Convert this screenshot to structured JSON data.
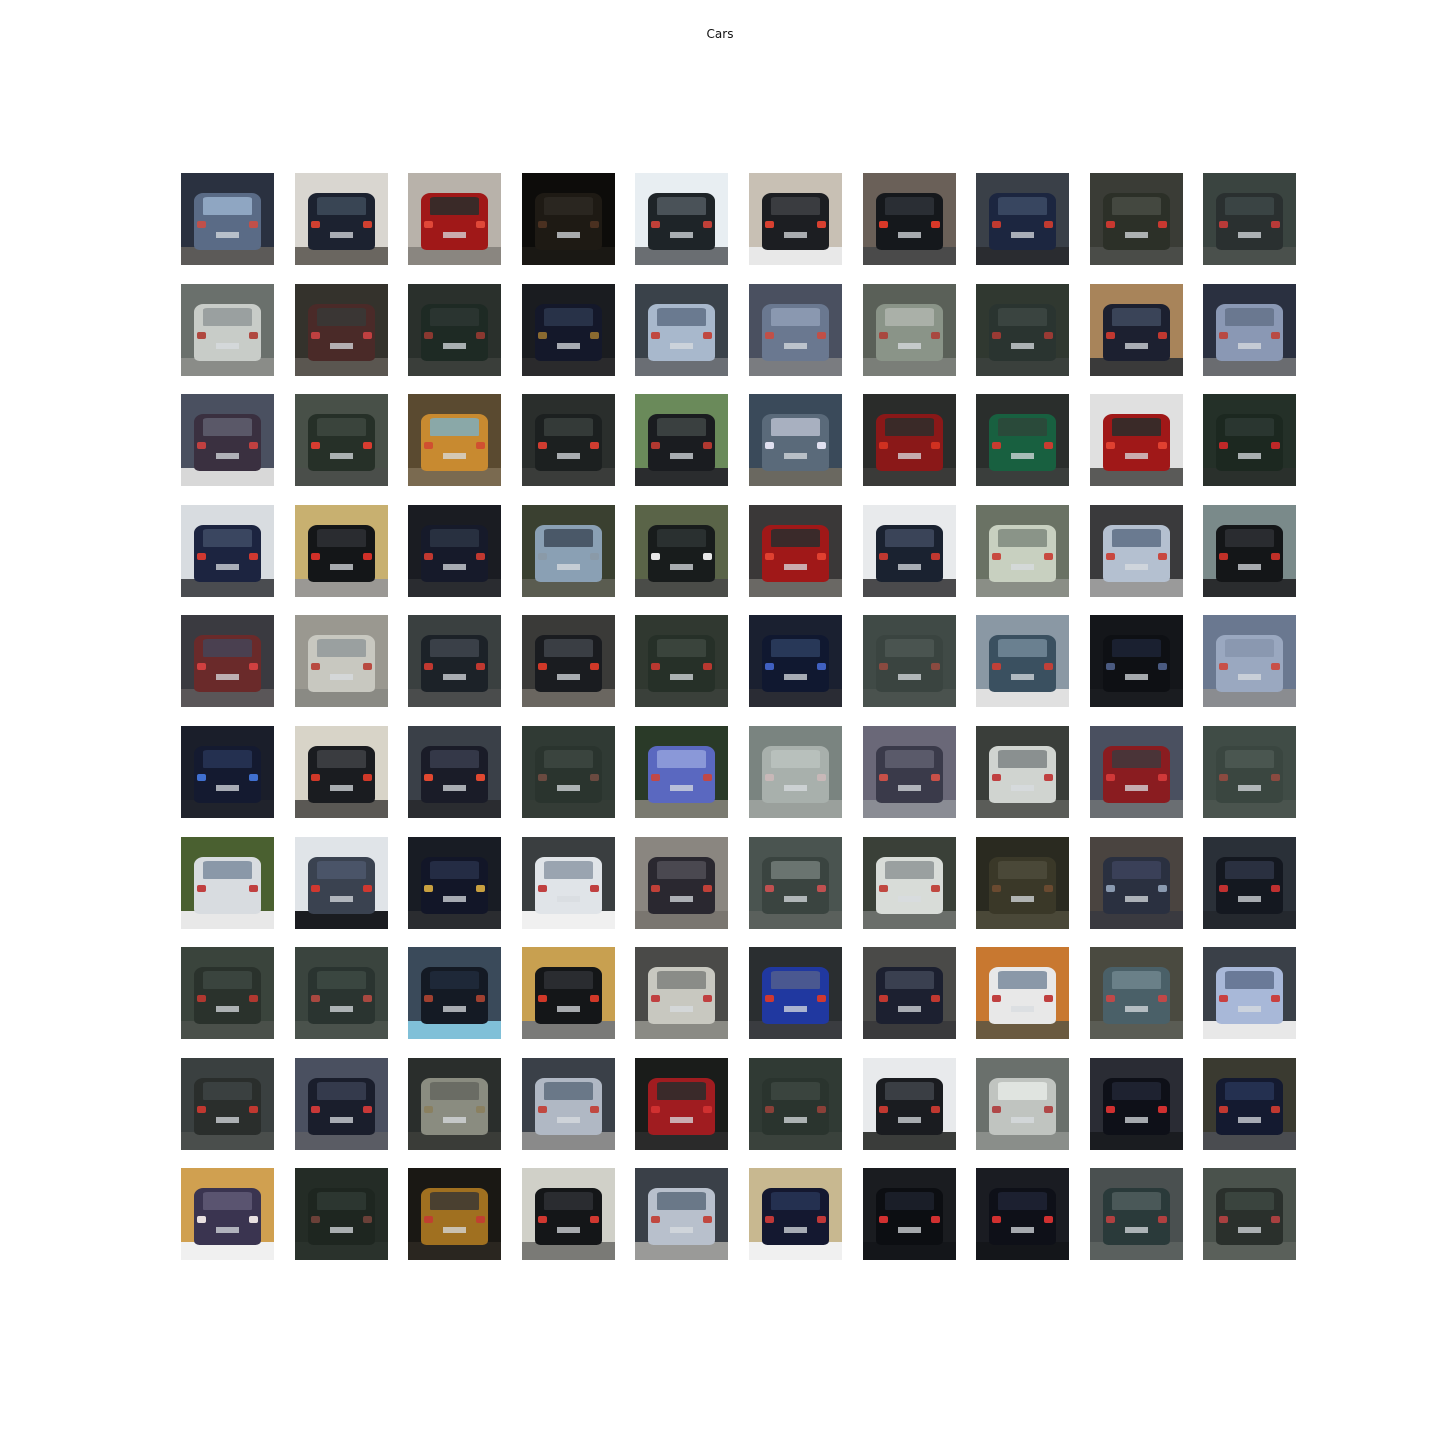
{
  "figure": {
    "title": "Cars"
  },
  "grid": {
    "rows": 10,
    "cols": 10,
    "thumbnails": [
      {
        "body": "#5a6b86",
        "bg": "#2a3140",
        "road": "#5c5a58",
        "light": "#c0504a",
        "window": "#8fa6c2"
      },
      {
        "body": "#1c2230",
        "bg": "#d9d6d0",
        "road": "#6a6660",
        "light": "#d04030",
        "window": "#394554"
      },
      {
        "body": "#a01818",
        "bg": "#b8b2aa",
        "road": "#8a8680",
        "light": "#e04838",
        "window": "#3a2a28"
      },
      {
        "body": "#1e1a14",
        "bg": "#0d0c0a",
        "road": "#1a1814",
        "light": "#4a3020",
        "window": "#2a2620"
      },
      {
        "body": "#1e2428",
        "bg": "#e8eef2",
        "road": "#6a6e72",
        "light": "#c04038",
        "window": "#4a5258"
      },
      {
        "body": "#1c1e22",
        "bg": "#c8c0b4",
        "road": "#e8e8e8",
        "light": "#d84030",
        "window": "#3a3c40"
      },
      {
        "body": "#15181c",
        "bg": "#6a6058",
        "road": "#4a4a4a",
        "light": "#d83828",
        "window": "#2a2e34"
      },
      {
        "body": "#1c2640",
        "bg": "#3a4048",
        "road": "#2a2c30",
        "light": "#c03a30",
        "window": "#384660"
      },
      {
        "body": "#2c3028",
        "bg": "#3a3c36",
        "road": "#4a4c48",
        "light": "#c83830",
        "window": "#444840"
      },
      {
        "body": "#2a3030",
        "bg": "#3a4440",
        "road": "#4a504c",
        "light": "#b83a38",
        "window": "#3a4444"
      },
      {
        "body": "#c8ccc8",
        "bg": "#6a706c",
        "road": "#8a8c88",
        "light": "#b04840",
        "window": "#9aa0a0"
      },
      {
        "body": "#4a2a28",
        "bg": "#34322c",
        "road": "#5a5650",
        "light": "#c04040",
        "window": "#3a3634"
      },
      {
        "body": "#1e2a24",
        "bg": "#2a302c",
        "road": "#3a3e3a",
        "light": "#8a3830",
        "window": "#2a3430"
      },
      {
        "body": "#14182a",
        "bg": "#1a1c20",
        "road": "#2a2a2c",
        "light": "#8a6a30",
        "window": "#283248"
      },
      {
        "body": "#a8b8cc",
        "bg": "#3a424a",
        "road": "#6a6e74",
        "light": "#c04840",
        "window": "#6a7a90"
      },
      {
        "body": "#6a7890",
        "bg": "#4a5060",
        "road": "#7a7c80",
        "light": "#c05048",
        "window": "#8a98b0"
      },
      {
        "body": "#8a9488",
        "bg": "#5a6058",
        "road": "#7a7e78",
        "light": "#a84840",
        "window": "#aab0a8"
      },
      {
        "body": "#2a3430",
        "bg": "#303830",
        "road": "#3a403c",
        "light": "#9a3a34",
        "window": "#3a4440"
      },
      {
        "body": "#1c2030",
        "bg": "#a8845a",
        "road": "#3a3a3a",
        "light": "#c03830",
        "window": "#3a4458"
      },
      {
        "body": "#8a98b4",
        "bg": "#2a3040",
        "road": "#6a6c70",
        "light": "#b84a44",
        "window": "#6a7890"
      },
      {
        "body": "#3a3040",
        "bg": "#4a5060",
        "road": "#d8d8d8",
        "light": "#c04040",
        "window": "#5a5868"
      },
      {
        "body": "#263028",
        "bg": "#485048",
        "road": "#4a4e4a",
        "light": "#d83c30",
        "window": "#3a443c"
      },
      {
        "body": "#c88a30",
        "bg": "#5a4a30",
        "road": "#7a6a50",
        "light": "#d05030",
        "window": "#8aa8a8"
      },
      {
        "body": "#1c2020",
        "bg": "#2a2e2c",
        "road": "#3a3c3a",
        "light": "#d03c30",
        "window": "#343a38"
      },
      {
        "body": "#1a1c20",
        "bg": "#6a8a5a",
        "road": "#2a2c2e",
        "light": "#b03830",
        "window": "#3a4040"
      },
      {
        "body": "#5a6a7a",
        "bg": "#3a4a5a",
        "road": "#6a6860",
        "light": "#e0e0f0",
        "window": "#a8b0c0"
      },
      {
        "body": "#8a1818",
        "bg": "#2a2c2a",
        "road": "#3a3a38",
        "light": "#d03020",
        "window": "#3a2a28"
      },
      {
        "body": "#186040",
        "bg": "#2a2e2c",
        "road": "#3a3e3c",
        "light": "#c83c30",
        "window": "#2a4a3a"
      },
      {
        "body": "#a01818",
        "bg": "#e0e0e0",
        "road": "#5a5a58",
        "light": "#e04030",
        "window": "#3a2a28"
      },
      {
        "body": "#1c2820",
        "bg": "#243028",
        "road": "#2a302c",
        "light": "#c02828",
        "window": "#2a3630"
      },
      {
        "body": "#1c2440",
        "bg": "#d8dce0",
        "road": "#4a4c50",
        "light": "#d03830",
        "window": "#3a4660"
      },
      {
        "body": "#141618",
        "bg": "#c8b070",
        "road": "#9a9894",
        "light": "#d03028",
        "window": "#2a2c30"
      },
      {
        "body": "#161a2a",
        "bg": "#1a1c22",
        "road": "#2a2c30",
        "light": "#c03830",
        "window": "#283040"
      },
      {
        "body": "#8aa0b4",
        "bg": "#3a4030",
        "road": "#5a5c50",
        "light": "#8a9aa8",
        "window": "#4a5868"
      },
      {
        "body": "#181c1c",
        "bg": "#5a6448",
        "road": "#4a4c48",
        "light": "#e8e8e8",
        "window": "#2a3030"
      },
      {
        "body": "#a01818",
        "bg": "#3a3838",
        "road": "#6a6864",
        "light": "#e04030",
        "window": "#3a2a2a"
      },
      {
        "body": "#1a2230",
        "bg": "#e8eaec",
        "road": "#4a4a4c",
        "light": "#c03830",
        "window": "#3a4458"
      },
      {
        "body": "#c8d0c0",
        "bg": "#6a7264",
        "road": "#8a8e86",
        "light": "#c84a40",
        "window": "#8a9488"
      },
      {
        "body": "#b4c0d0",
        "bg": "#3a3a3c",
        "road": "#9a9a9a",
        "light": "#c84840",
        "window": "#6a7a90"
      },
      {
        "body": "#141618",
        "bg": "#7a8a8a",
        "road": "#2a2c2e",
        "light": "#c03028",
        "window": "#2a2c30"
      },
      {
        "body": "#6a2a2a",
        "bg": "#3a3a40",
        "road": "#5a5658",
        "light": "#d04040",
        "window": "#4a4050"
      },
      {
        "body": "#c8c8c0",
        "bg": "#9a9890",
        "road": "#8a8a84",
        "light": "#b84a40",
        "window": "#9aa0a0"
      },
      {
        "body": "#1c2228",
        "bg": "#3a4040",
        "road": "#4a4c4c",
        "light": "#c03830",
        "window": "#3a4048"
      },
      {
        "body": "#1a1c20",
        "bg": "#3a3a38",
        "road": "#6a6660",
        "light": "#d03828",
        "window": "#3a3e44"
      },
      {
        "body": "#263028",
        "bg": "#303830",
        "road": "#3a403a",
        "light": "#b83830",
        "window": "#3a443c"
      },
      {
        "body": "#101830",
        "bg": "#1a2030",
        "road": "#2a2c34",
        "light": "#4060c0",
        "window": "#283858"
      },
      {
        "body": "#3a4440",
        "bg": "#404a46",
        "road": "#4a524e",
        "light": "#8a4a40",
        "window": "#4a5450"
      },
      {
        "body": "#3a5060",
        "bg": "#8a98a4",
        "road": "#e0e0e0",
        "light": "#c04038",
        "window": "#6a8090"
      },
      {
        "body": "#0e1014",
        "bg": "#14161a",
        "road": "#1a1c20",
        "light": "#4a5a80",
        "window": "#1a2030"
      },
      {
        "body": "#9aa8c0",
        "bg": "#6a7890",
        "road": "#8a8c90",
        "light": "#c85048",
        "window": "#8a98b0"
      },
      {
        "body": "#141a30",
        "bg": "#1a1e2a",
        "road": "#20232c",
        "light": "#4070d0",
        "window": "#243050"
      },
      {
        "body": "#1a1c20",
        "bg": "#d8d4c8",
        "road": "#5a5854",
        "light": "#d03828",
        "window": "#3a3c40"
      },
      {
        "body": "#1a1c28",
        "bg": "#3a4048",
        "road": "#2a2c30",
        "light": "#e04830",
        "window": "#343848"
      },
      {
        "body": "#2a342e",
        "bg": "#303a34",
        "road": "#343c36",
        "light": "#6a4a40",
        "window": "#3a443e"
      },
      {
        "body": "#5a68c0",
        "bg": "#2a3a28",
        "road": "#7a7a70",
        "light": "#c04848",
        "window": "#8a98d8"
      },
      {
        "body": "#a8b0ac",
        "bg": "#7a8480",
        "road": "#9aa09c",
        "light": "#c8b8b8",
        "window": "#b8c0bc"
      },
      {
        "body": "#3a3a4a",
        "bg": "#6a6878",
        "road": "#8a8c94",
        "light": "#c85048",
        "window": "#5a5a6a"
      },
      {
        "body": "#d0d4d0",
        "bg": "#3a3e3a",
        "road": "#5a5c58",
        "light": "#c04040",
        "window": "#8a9090"
      },
      {
        "body": "#8a1c20",
        "bg": "#4a5060",
        "road": "#6a6e72",
        "light": "#d03838",
        "window": "#4a3438"
      },
      {
        "body": "#3a4640",
        "bg": "#404c46",
        "road": "#4a544e",
        "light": "#8a4a40",
        "window": "#4a5650"
      },
      {
        "body": "#d8dce0",
        "bg": "#4a6030",
        "road": "#e8e8e8",
        "light": "#c04040",
        "window": "#8a98a8"
      },
      {
        "body": "#3a4250",
        "bg": "#e0e4e8",
        "road": "#1a1c20",
        "light": "#d03830",
        "window": "#4a5468"
      },
      {
        "body": "#121628",
        "bg": "#181c24",
        "road": "#2a2c30",
        "light": "#c8a040",
        "window": "#242c44"
      },
      {
        "body": "#e0e4e8",
        "bg": "#3a3e40",
        "road": "#f0f0f0",
        "light": "#c04040",
        "window": "#9aa4b0"
      },
      {
        "body": "#2a2830",
        "bg": "#8a8680",
        "road": "#7a7670",
        "light": "#c04038",
        "window": "#4a4850"
      },
      {
        "body": "#3a4440",
        "bg": "#4a5450",
        "road": "#5a605c",
        "light": "#c05050",
        "window": "#6a7470"
      },
      {
        "body": "#d8dcd8",
        "bg": "#3a4038",
        "road": "#6a6e6a",
        "light": "#c04840",
        "window": "#9aa0a0"
      },
      {
        "body": "#3a3828",
        "bg": "#2a2a20",
        "road": "#4a4838",
        "light": "#6a4a30",
        "window": "#4a4838"
      },
      {
        "body": "#2a3040",
        "bg": "#4a4440",
        "road": "#3a3a40",
        "light": "#8a9ab0",
        "window": "#3a4058"
      },
      {
        "body": "#141820",
        "bg": "#2a3038",
        "road": "#24282e",
        "light": "#c03030",
        "window": "#2a3040"
      },
      {
        "body": "#2a322c",
        "bg": "#3a443c",
        "road": "#4a504a",
        "light": "#b03830",
        "window": "#3a443e"
      },
      {
        "body": "#2a3430",
        "bg": "#3a443e",
        "road": "#4a524c",
        "light": "#a84840",
        "window": "#3a4640"
      },
      {
        "body": "#141a24",
        "bg": "#3a4a5a",
        "road": "#80c0d8",
        "light": "#a04030",
        "window": "#1e2838"
      },
      {
        "body": "#141618",
        "bg": "#c8a050",
        "road": "#7a7a78",
        "light": "#d03828",
        "window": "#2a2c30"
      },
      {
        "body": "#c8c8c0",
        "bg": "#4a4a48",
        "road": "#8a8a84",
        "light": "#c04040",
        "window": "#8a8c88"
      },
      {
        "body": "#2038a0",
        "bg": "#2a2e30",
        "road": "#3a3c40",
        "light": "#d03830",
        "window": "#4a5890"
      },
      {
        "body": "#1c2030",
        "bg": "#4a4a48",
        "road": "#3a3a3c",
        "light": "#c03830",
        "window": "#3a4050"
      },
      {
        "body": "#e8e8e8",
        "bg": "#c87830",
        "road": "#6a5a40",
        "light": "#c04040",
        "window": "#8a98a8"
      },
      {
        "body": "#4a6068",
        "bg": "#4a4a40",
        "road": "#5a5c54",
        "light": "#c04848",
        "window": "#6a8088"
      },
      {
        "body": "#a8b8d8",
        "bg": "#3a4048",
        "road": "#e8e8e8",
        "light": "#c84040",
        "window": "#6a7a98"
      },
      {
        "body": "#2a2e2c",
        "bg": "#3a4040",
        "road": "#4a4e4c",
        "light": "#c03830",
        "window": "#3a4040"
      },
      {
        "body": "#1a1e2c",
        "bg": "#4a5060",
        "road": "#5a5c64",
        "light": "#c83838",
        "window": "#343a4c"
      },
      {
        "body": "#8a8c80",
        "bg": "#2a2e2c",
        "road": "#3a3c38",
        "light": "#8a8060",
        "window": "#6a6c64"
      },
      {
        "body": "#b0b8c4",
        "bg": "#3a4048",
        "road": "#8a8a8a",
        "light": "#c04840",
        "window": "#6a7888"
      },
      {
        "body": "#a01c20",
        "bg": "#1a1c1a",
        "road": "#2a2a2a",
        "light": "#d03030",
        "window": "#3a2a2a"
      },
      {
        "body": "#2a342e",
        "bg": "#303a34",
        "road": "#3a423c",
        "light": "#8a4038",
        "window": "#3a443e"
      },
      {
        "body": "#1a1c20",
        "bg": "#e8eaec",
        "road": "#3a3c3a",
        "light": "#c03830",
        "window": "#3a3e44"
      },
      {
        "body": "#c0c4c0",
        "bg": "#6a706c",
        "road": "#8a8e8a",
        "light": "#b04848",
        "window": "#e0e4e0"
      },
      {
        "body": "#0e1018",
        "bg": "#2a2c34",
        "road": "#1a1c20",
        "light": "#d03030",
        "window": "#1e2230"
      },
      {
        "body": "#141a30",
        "bg": "#3a3a30",
        "road": "#4a4c50",
        "light": "#c03830",
        "window": "#243050"
      },
      {
        "body": "#3a3450",
        "bg": "#d0a050",
        "road": "#f0f0f0",
        "light": "#e8e0e0",
        "window": "#5a5470"
      },
      {
        "body": "#1e2620",
        "bg": "#242c26",
        "road": "#2a322c",
        "light": "#6a4038",
        "window": "#2c3630"
      },
      {
        "body": "#a07020",
        "bg": "#1a1814",
        "road": "#2a2620",
        "light": "#c04030",
        "window": "#4a4030"
      },
      {
        "body": "#141618",
        "bg": "#d0d0c8",
        "road": "#7a7a76",
        "light": "#d03830",
        "window": "#2a2c30"
      },
      {
        "body": "#b8c0cc",
        "bg": "#3a4048",
        "road": "#9a9a98",
        "light": "#c04840",
        "window": "#6a7888"
      },
      {
        "body": "#141830",
        "bg": "#c8b890",
        "road": "#f0f0f0",
        "light": "#c03838",
        "window": "#243050"
      },
      {
        "body": "#0c0e12",
        "bg": "#1a1c20",
        "road": "#14161a",
        "light": "#d03030",
        "window": "#1a1e28"
      },
      {
        "body": "#0e1018",
        "bg": "#1a1c22",
        "road": "#14161a",
        "light": "#d03030",
        "window": "#1c2030"
      },
      {
        "body": "#2a3a3a",
        "bg": "#4a5050",
        "road": "#5a605e",
        "light": "#b04040",
        "window": "#4a5858"
      },
      {
        "body": "#2a302c",
        "bg": "#4a524c",
        "road": "#5a605a",
        "light": "#a84040",
        "window": "#3a443e"
      }
    ]
  }
}
